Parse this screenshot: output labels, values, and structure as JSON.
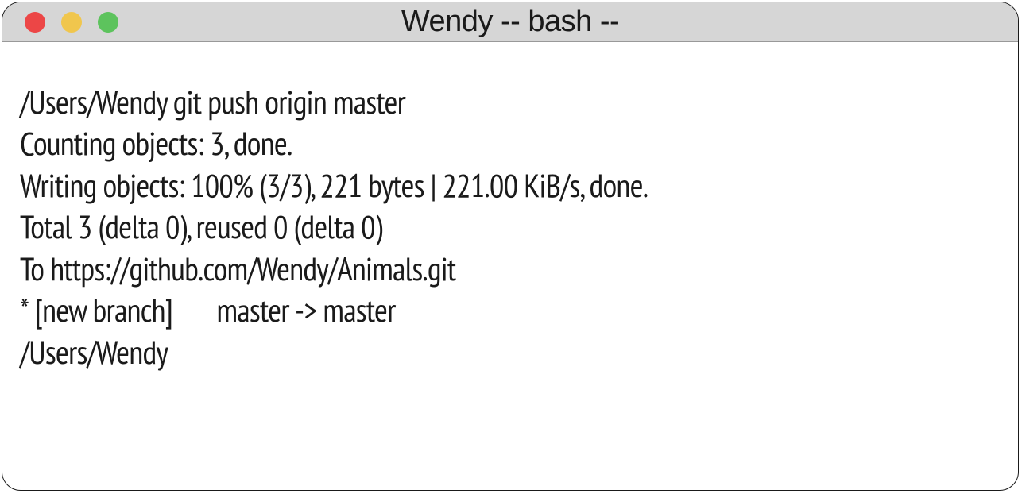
{
  "window": {
    "title": "Wendy -- bash --"
  },
  "terminal": {
    "lines": [
      "/Users/Wendy git push origin master",
      "Counting objects: 3, done.",
      "Writing objects: 100% (3/3), 221 bytes | 221.00 KiB/s, done.",
      "Total 3 (delta 0), reused 0 (delta 0)",
      "To https://github.com/Wendy/Animals.git",
      "* [new branch]       master -> master",
      "/Users/Wendy"
    ]
  },
  "traffic_lights": {
    "red": "#ec4646",
    "yellow": "#f0c64d",
    "green": "#5dc35d"
  }
}
